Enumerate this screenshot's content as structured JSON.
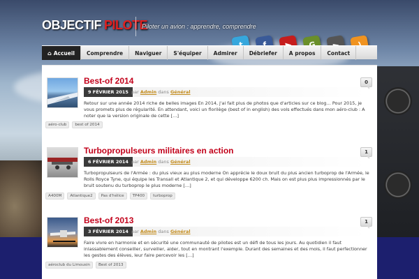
{
  "brand": {
    "word1": "OBJECTIF",
    "word2": "PILOTE",
    "tagline": "Piloter un avion : apprendre, comprendre"
  },
  "social": [
    {
      "icon": "twitter-icon",
      "glyph": "t",
      "color": "#36a7dd"
    },
    {
      "icon": "facebook-icon",
      "glyph": "f",
      "color": "#3a5a98"
    },
    {
      "icon": "youtube-icon",
      "glyph": "▶",
      "color": "#c61d1d"
    },
    {
      "icon": "google-icon",
      "glyph": "G",
      "color": "#6a8f2a"
    },
    {
      "icon": "play-icon",
      "glyph": "►",
      "color": "#555555"
    },
    {
      "icon": "rss-icon",
      "glyph": ")",
      "color": "#f09320"
    }
  ],
  "nav": [
    {
      "label": "Accueil",
      "active": true
    },
    {
      "label": "Comprendre"
    },
    {
      "label": "Naviguer"
    },
    {
      "label": "S'équiper"
    },
    {
      "label": "Admirer"
    },
    {
      "label": "Débriefer"
    },
    {
      "label": "A propos"
    },
    {
      "label": "Contact"
    }
  ],
  "meta_words": {
    "by": "par",
    "in": "dans"
  },
  "posts": [
    {
      "title": "Best-of 2014",
      "date": "9 FÉVRIER 2015",
      "author": "Admin",
      "category": "Général",
      "comments": "0",
      "excerpt": "Retour sur une année 2014 riche de belles images    En 2014, j'ai fait plus de photos que d'articles sur ce blog… Pour 2015, je vous promets plus de régularité. En attendant, voici un florilège (best of in english) des vols effectués dans mon aéro-club : A noter que la version originale de cette […]",
      "tags": [
        "aéro-club",
        "best of 2014"
      ]
    },
    {
      "title": "Turbopropulseurs militaires en action",
      "date": "6 FÉVRIER 2014",
      "author": "Admin",
      "category": "Général",
      "comments": "1",
      "excerpt": "Turbopropulseurs de l'Armée : du plus vieux au plus moderne On apprécie le doux bruit du plus ancien turboprop de l'Armée, le Rolls Royce Tyne, qui équipe les Transall et Atlantique 2, et qui développe 6200 ch. Mais on est plus plus impressionnés par le bruit  soutenu du turboprop le plus moderne […]",
      "tags": [
        "A400M",
        "Atlantique2",
        "Pas d'hélice",
        "TP400",
        "turboprop"
      ]
    },
    {
      "title": "Best-of 2013",
      "date": "3 FÉVRIER 2014",
      "author": "Admin",
      "category": "Général",
      "comments": "1",
      "excerpt": "Faire vivre en harmonie et en sécurité une communauté de pilotes est un défi de tous les jours. Au quotidien il faut inlassablement conseiller, surveiller, aider, tout en montrant l'exemple. Durant des semaines et des mois, il faut  perfectionner les gestes des élèves, leur faire percevoir les […]",
      "tags": [
        "aéroclub du Limousin",
        "Best of 2013"
      ]
    }
  ]
}
